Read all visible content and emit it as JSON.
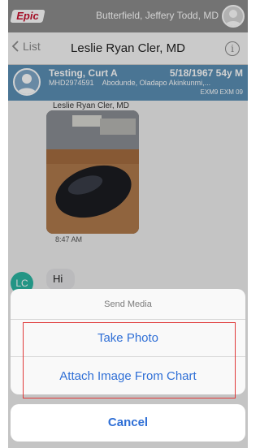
{
  "app": {
    "logo": "Epic",
    "user_name": "Butterfield, Jeffery Todd, MD"
  },
  "nav": {
    "back_label": "List",
    "title": "Leslie Ryan Cler, MD",
    "info_glyph": "i"
  },
  "patient": {
    "name": "Testing, Curt A",
    "dob_age_sex": "5/18/1967 54y M",
    "mrn": "MHD2974591",
    "provider": "Abodunde, Oladapo Akinkunmi,...",
    "location": "EXM9 EXM 09"
  },
  "chat": {
    "sender_name": "Leslie Ryan Cler, MD",
    "photo_time": "8:47 AM",
    "avatar_initials": "LC",
    "message_text": "Hi"
  },
  "sheet": {
    "title": "Send Media",
    "take_photo": "Take Photo",
    "attach_image": "Attach Image From Chart",
    "cancel": "Cancel"
  },
  "colors": {
    "accent": "#2f6fd6",
    "banner": "#5b8fb5",
    "topbar": "#8d8d8d",
    "highlight": "#e03a3a",
    "avatar_lc": "#2bb6a3"
  }
}
